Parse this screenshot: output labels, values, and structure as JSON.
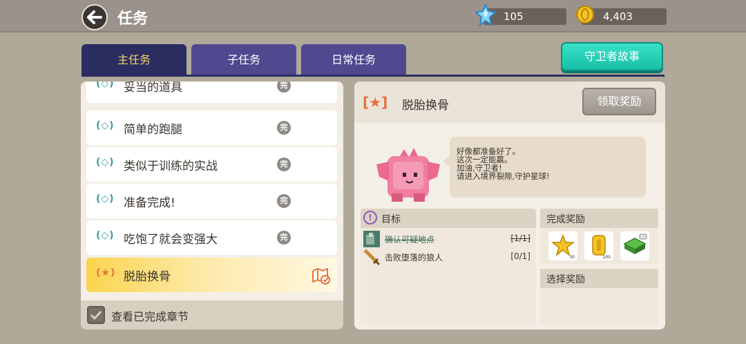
{
  "header": {
    "title": "任务",
    "gems": "105",
    "coins": "4,403"
  },
  "tabs": [
    {
      "label": "主任务",
      "active": true
    },
    {
      "label": "子任务",
      "active": false
    },
    {
      "label": "日常任务",
      "active": false
    }
  ],
  "story_button": "守卫者故事",
  "quest_list": {
    "items": [
      {
        "icon": "(◇)",
        "name": "妥当的道具",
        "status": "完"
      },
      {
        "icon": "(◇)",
        "name": "简单的跑腿",
        "status": "完"
      },
      {
        "icon": "(◇)",
        "name": "类似于训练的实战",
        "status": "完"
      },
      {
        "icon": "(◇)",
        "name": "准备完成!",
        "status": "完"
      },
      {
        "icon": "(◇)",
        "name": "吃饱了就会变强大",
        "status": "完"
      },
      {
        "icon": "(★)",
        "name": "脱胎换骨",
        "status": ""
      }
    ],
    "view_completed": "查看已完成章节"
  },
  "detail": {
    "title": "脱胎换骨",
    "star_icon": "[★]",
    "claim_button": "领取奖励",
    "dialog": [
      "好像都准备好了。",
      "这次一定能赢。",
      "加油,守卫者!",
      "请进入境界裂隙,守护星球!"
    ],
    "goal_header": "目标",
    "goals": [
      {
        "text": "确认可疑地点",
        "count": "[1/1]",
        "done": true
      },
      {
        "text": "击败堕落的狼人",
        "count": "[0/1]",
        "done": false
      }
    ],
    "reward_header": "完成奖励",
    "rewards": [
      {
        "icon": "star-token-icon",
        "qty": "30"
      },
      {
        "icon": "gold-coin-icon",
        "qty": "200"
      },
      {
        "icon": "xp-block-icon",
        "qty": ""
      }
    ],
    "select_header": "选择奖励"
  },
  "colors": {
    "tab_active": "#2b2d61",
    "tab_inactive": "#4f4990",
    "accent_teal": "#18bfa7",
    "active_quest": "#fbd44f"
  }
}
